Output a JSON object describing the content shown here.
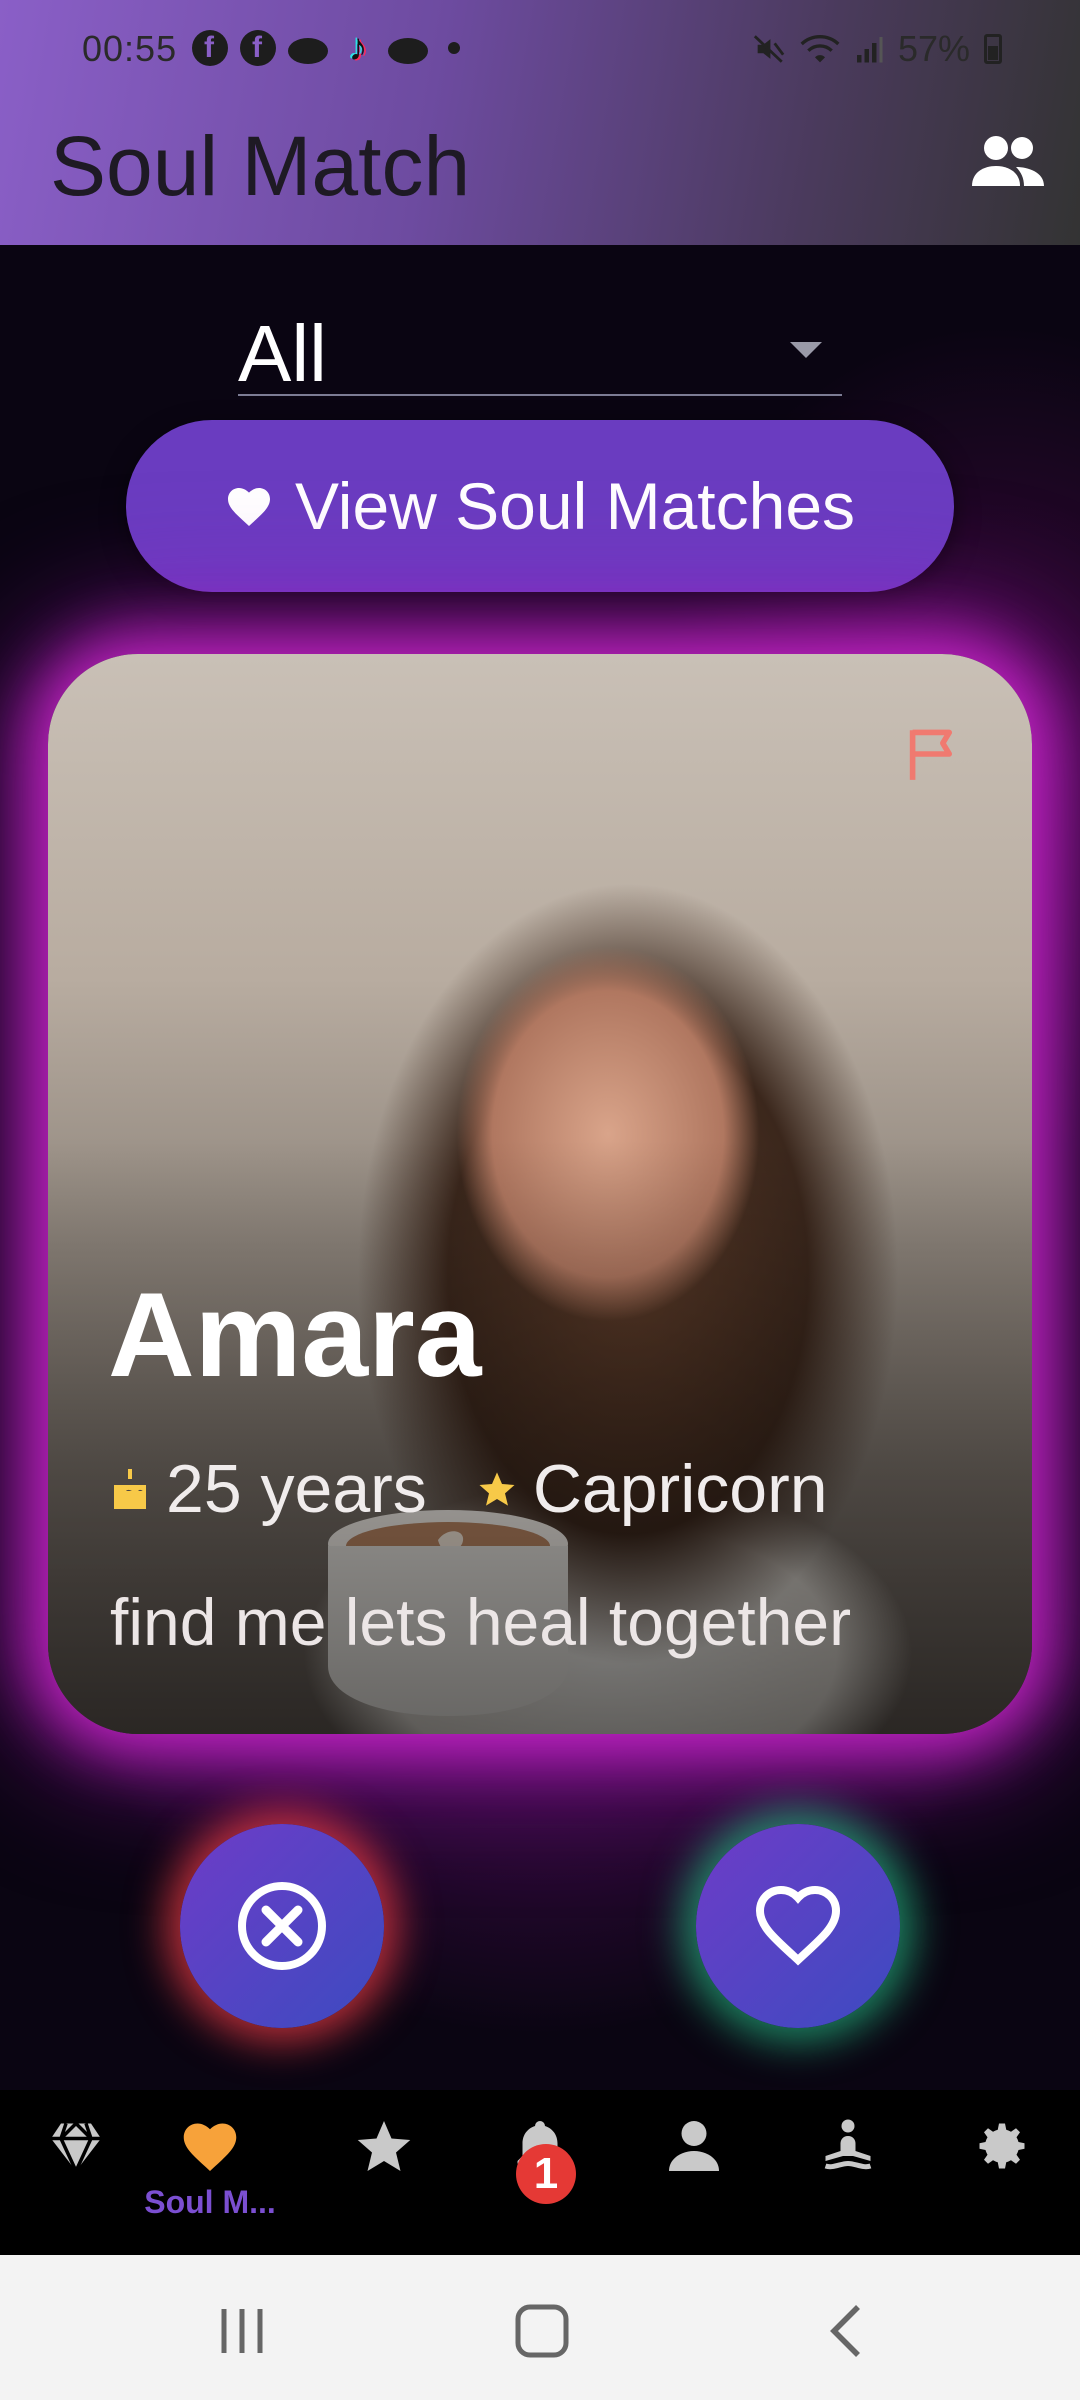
{
  "status_bar": {
    "time": "00:55",
    "battery": "57%",
    "left_icons": [
      "facebook-icon",
      "facebook-icon",
      "dish-app-icon",
      "tiktok-icon",
      "dish-app-icon",
      "dot-icon"
    ],
    "right_icons": [
      "mute-icon",
      "wifi-icon",
      "signal-icon",
      "battery-icon"
    ]
  },
  "app_bar": {
    "title": "Soul Match",
    "action_icon": "people-icon"
  },
  "filter": {
    "selected": "All"
  },
  "view_matches_button": {
    "label": "View Soul Matches",
    "icon": "heart-icon"
  },
  "profile_card": {
    "name": "Amara",
    "age": "25 years",
    "zodiac": "Capricorn",
    "bio": "find me lets heal together",
    "report_icon": "flag-icon"
  },
  "actions": {
    "reject_icon": "close-circle-icon",
    "like_icon": "heart-outline-icon"
  },
  "bottom_nav": {
    "items": [
      {
        "icon": "diamond-icon",
        "label": ""
      },
      {
        "icon": "heart-icon",
        "label": "Soul M..."
      },
      {
        "icon": "star-icon",
        "label": ""
      },
      {
        "icon": "bell-icon",
        "label": ""
      },
      {
        "icon": "person-icon",
        "label": ""
      },
      {
        "icon": "meditation-icon",
        "label": ""
      },
      {
        "icon": "gear-icon",
        "label": ""
      }
    ],
    "active_index": 1,
    "notification_badge": "1"
  },
  "colors": {
    "accent": "#6a3cc0",
    "active_nav": "#f7a23a",
    "active_label": "#7b4fd1",
    "badge": "#e53935",
    "card_glow": "#d228d2"
  }
}
